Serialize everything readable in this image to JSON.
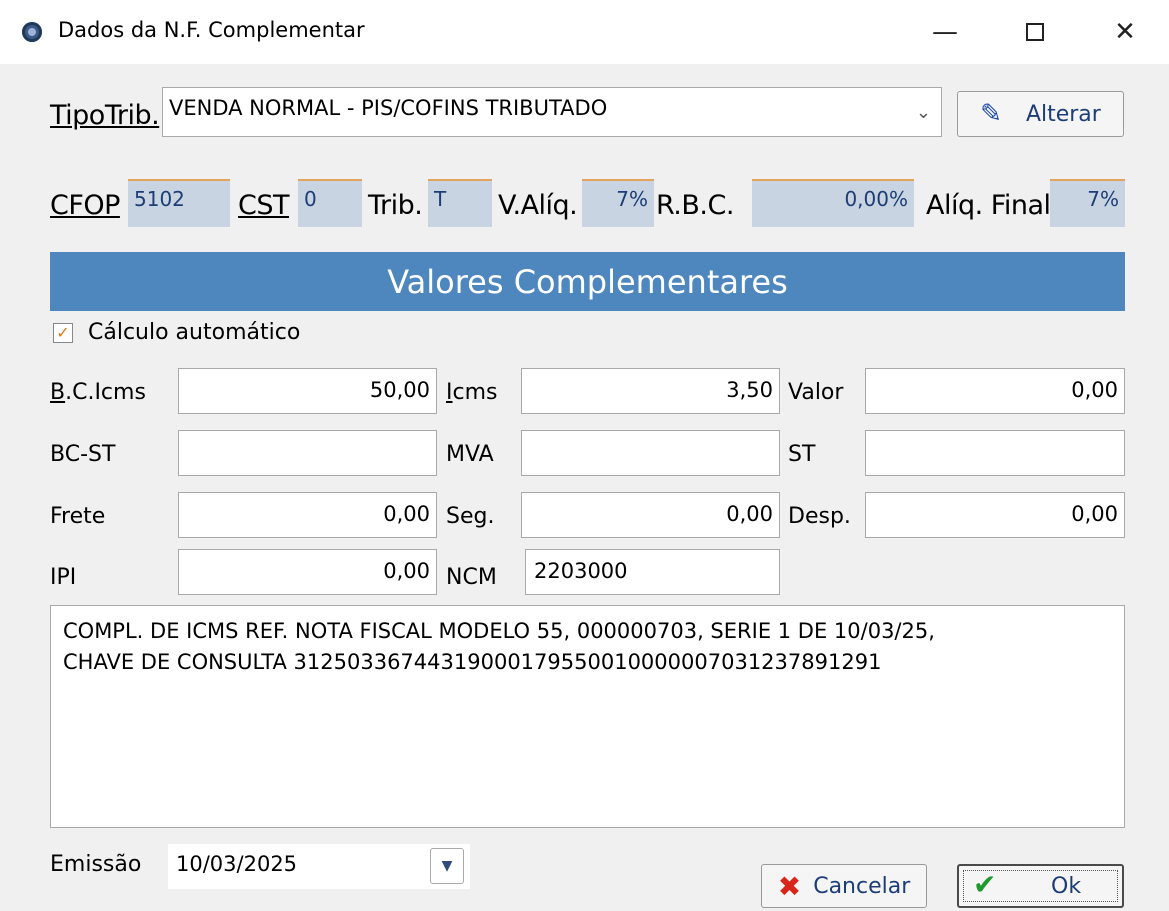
{
  "window": {
    "title": "Dados da  N.F. Complementar",
    "minimize": "—",
    "close": "✕"
  },
  "tipotrib": {
    "label": "TipoTrib.",
    "value": "VENDA NORMAL - PIS/COFINS TRIBUTADO",
    "alterar_label": "Alterar"
  },
  "info": {
    "cfop_label": "CFOP",
    "cfop_value": "5102",
    "cst_label": "CST",
    "cst_value": "0",
    "trib_label": "Trib.",
    "trib_value": "T",
    "valiq_label": "V.Alíq.",
    "valiq_value": "7%",
    "rbc_label": "R.B.C.",
    "rbc_value": "0,00%",
    "aliq_final_label": "Alíq. Final",
    "aliq_final_value": "7%"
  },
  "section": {
    "title": "Valores Complementares",
    "calc_auto_label": "Cálculo automático",
    "calc_auto_checked": true
  },
  "fields": {
    "bc_icms_label": "B.C.Icms",
    "bc_icms_value": "50,00",
    "icms_label": "Icms",
    "icms_value": "3,50",
    "valor_label": "Valor",
    "valor_value": "0,00",
    "bc_st_label": "BC-ST",
    "bc_st_value": "",
    "mva_label": "MVA",
    "mva_value": "",
    "st_label": "ST",
    "st_value": "",
    "frete_label": "Frete",
    "frete_value": "0,00",
    "seg_label": "Seg.",
    "seg_value": "0,00",
    "desp_label": "Desp.",
    "desp_value": "0,00",
    "ipi_label": "IPI",
    "ipi_value": "0,00",
    "ncm_label": "NCM",
    "ncm_value": "2203000"
  },
  "observacao": {
    "line1": "COMPL. DE ICMS REF. NOTA FISCAL MODELO 55, 000000703, SERIE 1 DE 10/03/25,",
    "line2": "CHAVE DE CONSULTA 31250336744319000179550010000007031237891291"
  },
  "emissao": {
    "label": "Emissão",
    "value": "10/03/2025"
  },
  "buttons": {
    "cancelar": "Cancelar",
    "ok": "Ok"
  }
}
